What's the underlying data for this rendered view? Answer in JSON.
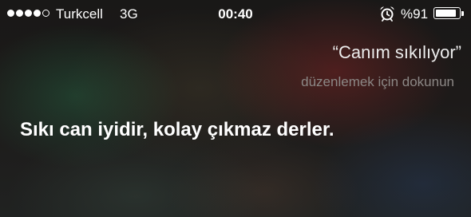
{
  "status_bar": {
    "signal_dots_filled": 4,
    "signal_dots_total": 5,
    "carrier": "Turkcell",
    "network": "3G",
    "time": "00:40",
    "alarm_icon": "alarm-clock-icon",
    "battery_percent": "%91",
    "battery_level": 0.91
  },
  "siri": {
    "user_query": "“Canım sıkılıyor”",
    "tap_to_edit": "düzenlemek için dokunun",
    "response": "Sıkı can iyidir, kolay çıkmaz derler."
  },
  "colors": {
    "text_primary": "#ffffff",
    "text_secondary": "#8c8886",
    "background": "#191817"
  }
}
